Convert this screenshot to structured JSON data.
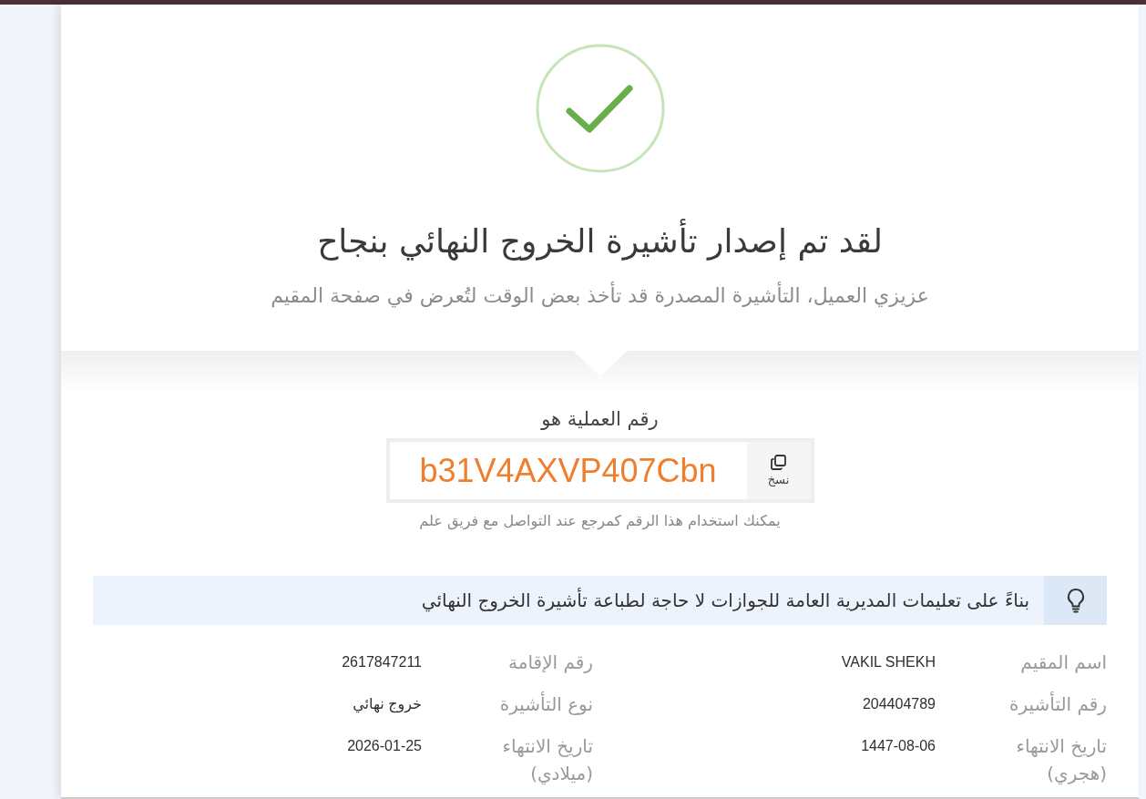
{
  "success": {
    "title": "لقد تم إصدار تأشيرة الخروج النهائي بنجاح",
    "subtitle": "عزيزي العميل، التأشيرة المصدرة قد تأخذ بعض الوقت لتُعرض في صفحة المقيم"
  },
  "transaction": {
    "label": "رقم العملية هو",
    "number": "b31V4AXVP407Cbn",
    "copy_button": "نسخ",
    "hint": "يمكنك استخدام هذا الرقم كمرجع عند التواصل مع فريق علم"
  },
  "notice": {
    "text": "بناءً على تعليمات المديرية العامة للجوازات لا حاجة لطباعة تأشيرة الخروج النهائي"
  },
  "details": [
    {
      "label": "اسم المقيم",
      "value": "VAKIL SHEKH"
    },
    {
      "label": "رقم الإقامة",
      "value": "2617847211"
    },
    {
      "label": "رقم التأشيرة",
      "value": "204404789"
    },
    {
      "label": "نوع التأشيرة",
      "value": "خروج نهائي"
    },
    {
      "label": "تاريخ الانتهاء (هجري)",
      "value": "1447-08-06"
    },
    {
      "label": "تاريخ الانتهاء (ميلادي)",
      "value": "2026-01-25"
    }
  ]
}
